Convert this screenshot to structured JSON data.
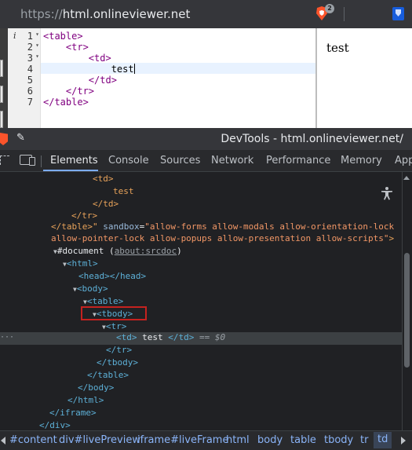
{
  "browser": {
    "url_scheme": "https://",
    "url_host": "html.onlineviewer.net",
    "shields_badge": "2"
  },
  "editor": {
    "info_marker": "i",
    "lines": [
      {
        "num": "1",
        "fold": "▾",
        "code": "<table>"
      },
      {
        "num": "2",
        "fold": "▾",
        "code": "    <tr>"
      },
      {
        "num": "3",
        "fold": "▾",
        "code": "        <td>"
      },
      {
        "num": "4",
        "fold": "",
        "code": "            test"
      },
      {
        "num": "5",
        "fold": "",
        "code": "        </td>"
      },
      {
        "num": "6",
        "fold": "",
        "code": "    </tr>"
      },
      {
        "num": "7",
        "fold": "",
        "code": "</table>"
      }
    ]
  },
  "preview": {
    "text": "test"
  },
  "devtools": {
    "title": "DevTools - html.onlineviewer.net/",
    "tabs": [
      "Elements",
      "Console",
      "Sources",
      "Network",
      "Performance",
      "Memory",
      "App"
    ],
    "active_tab": "Elements",
    "tree": {
      "r1": "<td>",
      "r2": "test",
      "r3": "</td>",
      "r4": "</tr>",
      "r5_a": "</table>\"",
      "r5_attr": "sandbox",
      "r5_eq": "=",
      "r5_val": "\"allow-forms allow-modals allow-orientation-lock",
      "r6_val": "allow-pointer-lock allow-popups allow-presentation allow-scripts\"",
      "r6_end": ">",
      "r7_a": "#document (",
      "r7_link": "about:srcdoc",
      "r7_b": ")",
      "r8": "<html>",
      "r9": "<head></head>",
      "r10": "<body>",
      "r11": "<table>",
      "r12": "<tbody>",
      "r13": "<tr>",
      "r14_tag": "<td>",
      "r14_text": " test ",
      "r14_close": "</td>",
      "r14_ref": " == $0",
      "r15": "</tr>",
      "r16": "</tbody>",
      "r17": "</table>",
      "r18": "</body>",
      "r19": "</html>",
      "r20": "</iframe>",
      "r21": "</div>",
      "dots": "···"
    },
    "breadcrumbs": [
      "#content",
      "div#livePreview",
      "iframe#liveFrame",
      "html",
      "body",
      "table",
      "tbody",
      "tr",
      "td"
    ],
    "active_breadcrumb": "td"
  }
}
